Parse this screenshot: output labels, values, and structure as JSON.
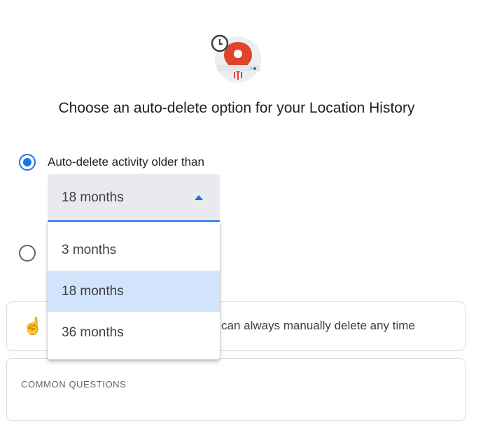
{
  "header": {
    "title": "Choose an auto-delete option for your Location History",
    "logo_icon": "location-history-clock-icon"
  },
  "option_auto": {
    "label": "Auto-delete activity older than",
    "selected": true
  },
  "option_other": {
    "selected": false
  },
  "select": {
    "value": "18 months",
    "options": [
      "3 months",
      "18 months",
      "36 months"
    ],
    "highlighted": "18 months"
  },
  "info_card": {
    "icon": "hand-touch-icon",
    "text": "can always manually delete any time"
  },
  "questions_card": {
    "header": "COMMON QUESTIONS"
  },
  "colors": {
    "accent": "#1a73e8",
    "highlight": "#d2e3fc",
    "logo_red": "#e0442b"
  }
}
